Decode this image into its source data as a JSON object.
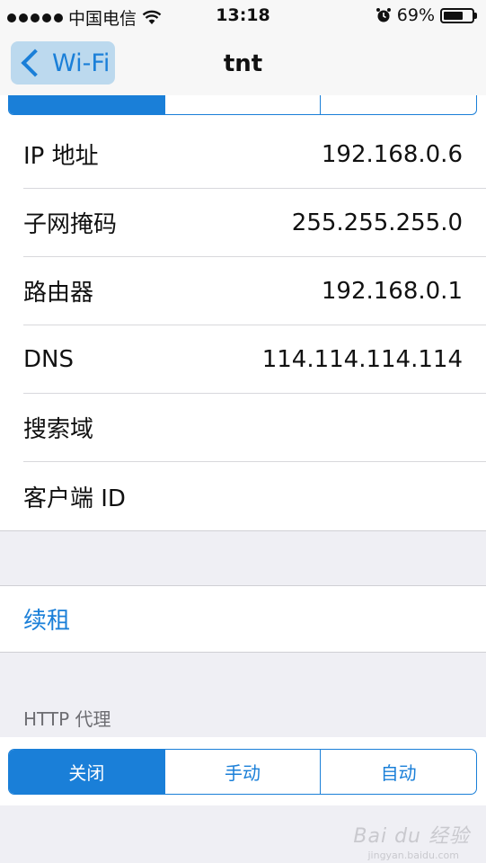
{
  "status_bar": {
    "carrier": "中国电信",
    "time": "13:18",
    "battery_percent": "69%",
    "battery_level": 0.69,
    "icons": [
      "signal-dots-icon",
      "wifi-icon",
      "alarm-icon",
      "battery-icon"
    ]
  },
  "nav": {
    "back_label": "Wi-Fi",
    "title": "tnt"
  },
  "info_rows": [
    {
      "label": "IP 地址",
      "value": "192.168.0.6"
    },
    {
      "label": "子网掩码",
      "value": "255.255.255.0"
    },
    {
      "label": "路由器",
      "value": "192.168.0.1"
    },
    {
      "label": "DNS",
      "value": "114.114.114.114"
    },
    {
      "label": "搜索域",
      "value": ""
    },
    {
      "label": "客户端 ID",
      "value": ""
    }
  ],
  "renew_label": "续租",
  "http_proxy": {
    "header": "HTTP 代理",
    "options": [
      "关闭",
      "手动",
      "自动"
    ],
    "selected": "关闭"
  },
  "watermark": {
    "main": "Bai du 经验",
    "sub": "jingyan.baidu.com"
  },
  "colors": {
    "accent": "#1a7fd8",
    "background": "#efeff4"
  }
}
